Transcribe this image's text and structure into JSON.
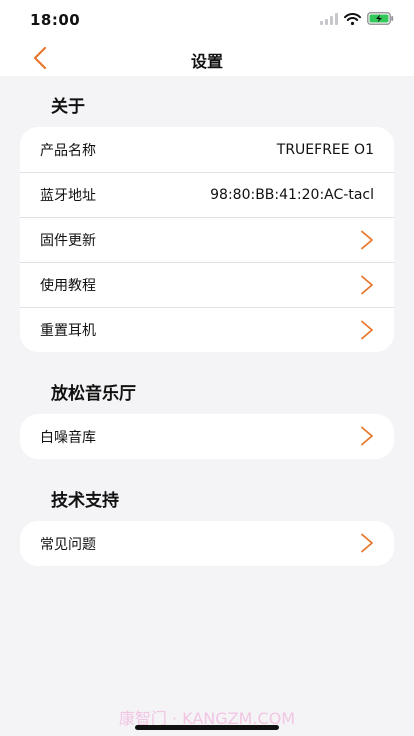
{
  "status_bar": {
    "time": "18:00"
  },
  "nav": {
    "title": "设置"
  },
  "sections": {
    "about": {
      "title": "关于",
      "product_name": {
        "label": "产品名称",
        "value": "TRUEFREE O1"
      },
      "bt_address": {
        "label": "蓝牙地址",
        "value": "98:80:BB:41:20:AC-tacl"
      },
      "firmware": {
        "label": "固件更新"
      },
      "tutorial": {
        "label": "使用教程"
      },
      "reset": {
        "label": "重置耳机"
      }
    },
    "music": {
      "title": "放松音乐厅",
      "white_noise": {
        "label": "白噪音库"
      }
    },
    "support": {
      "title": "技术支持",
      "faq": {
        "label": "常见问题"
      }
    }
  },
  "watermark": "康智门 · KANGZM.COM",
  "colors": {
    "accent": "#e8772e",
    "background": "#f4f4f7",
    "card": "#ffffff"
  },
  "icons": {
    "back": "chevron-left-icon",
    "row": "chevron-right-icon",
    "wifi": "wifi-icon",
    "battery": "battery-charging-icon"
  }
}
